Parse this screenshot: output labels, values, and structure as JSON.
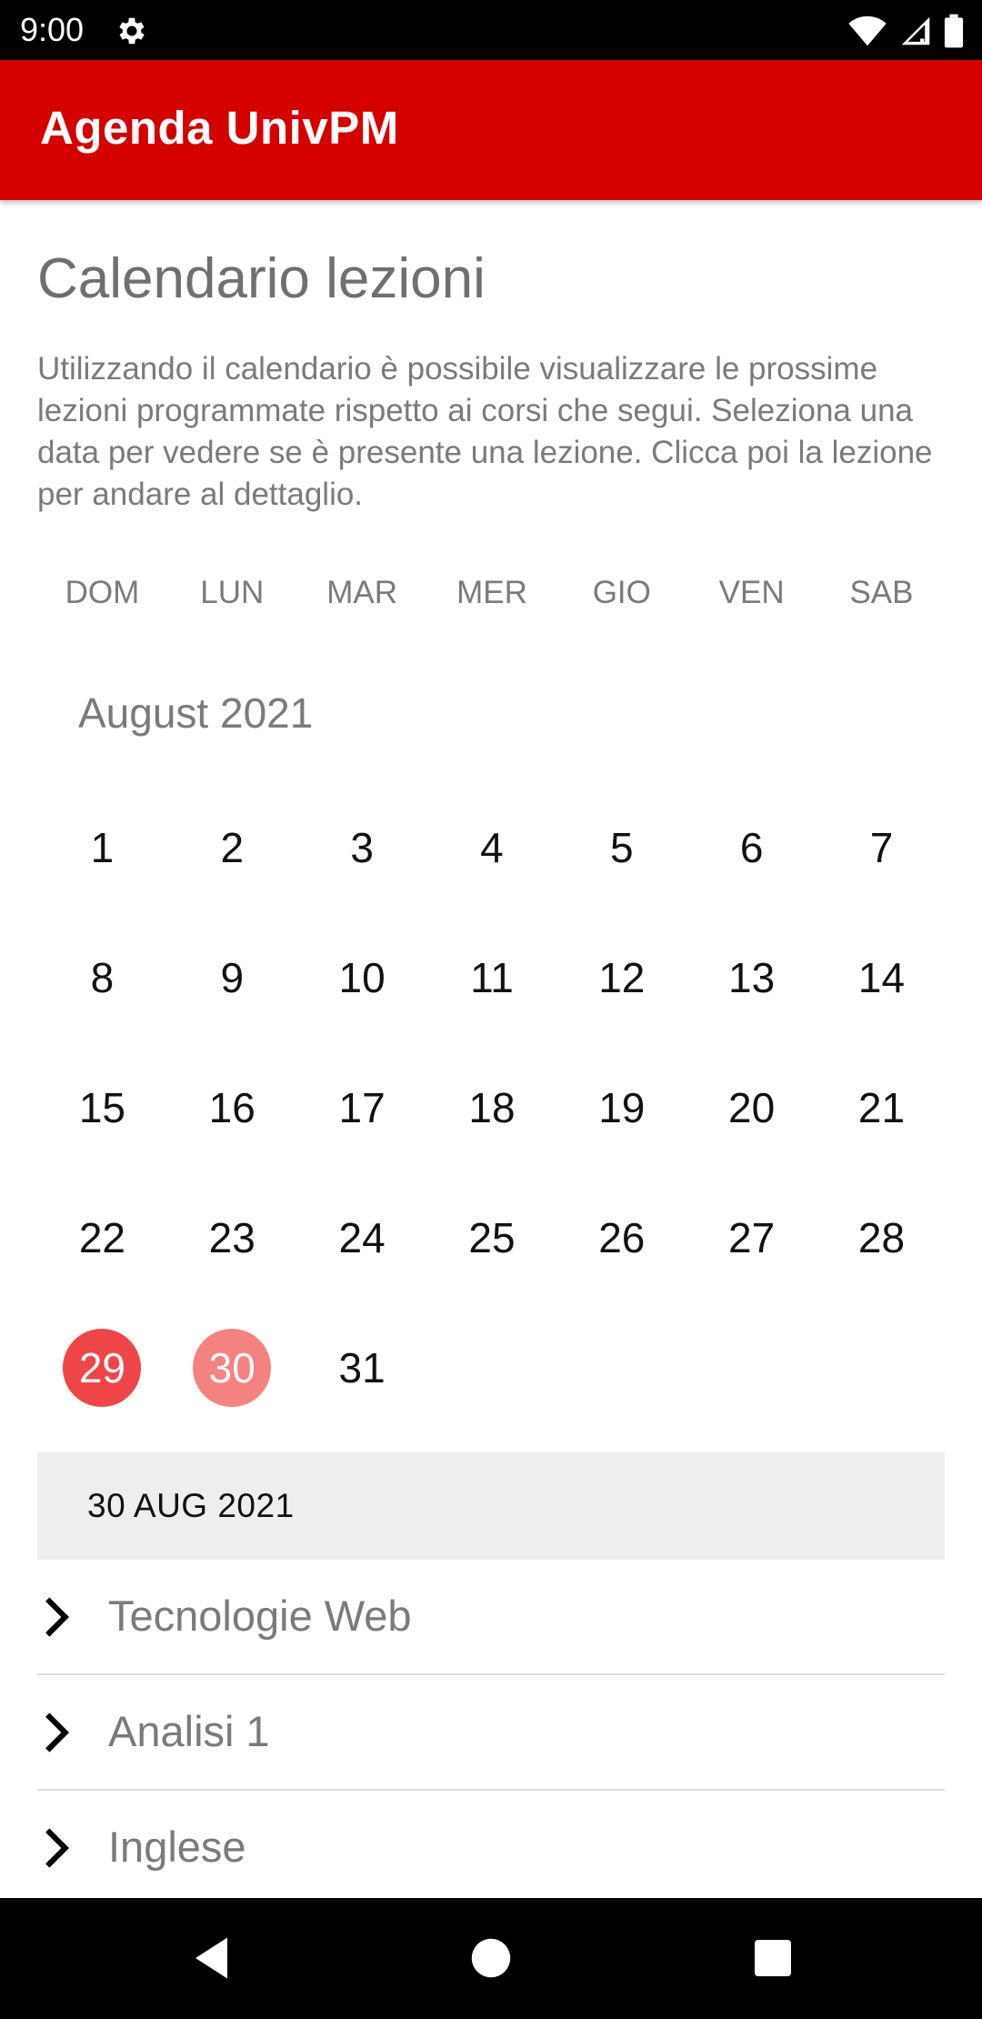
{
  "status_bar": {
    "time": "9:00",
    "icons": [
      "gear-icon",
      "wifi-icon",
      "cellular-signal-icon",
      "battery-icon"
    ]
  },
  "app_bar": {
    "title": "Agenda UnivPM",
    "color": "#d50000"
  },
  "page": {
    "title": "Calendario lezioni",
    "intro": "Utilizzando il calendario è possibile visualizzare le prossime lezioni programmate rispetto ai corsi che segui. Seleziona una data per vedere se è presente una lezione. Clicca poi la lezione per andare al dettaglio."
  },
  "calendar": {
    "weekdays": [
      "DOM",
      "LUN",
      "MAR",
      "MER",
      "GIO",
      "VEN",
      "SAB"
    ],
    "month_label": "August 2021",
    "weeks": [
      [
        "1",
        "2",
        "3",
        "4",
        "5",
        "6",
        "7"
      ],
      [
        "8",
        "9",
        "10",
        "11",
        "12",
        "13",
        "14"
      ],
      [
        "15",
        "16",
        "17",
        "18",
        "19",
        "20",
        "21"
      ],
      [
        "22",
        "23",
        "24",
        "25",
        "26",
        "27",
        "28"
      ],
      [
        "29",
        "30",
        "31",
        "",
        "",
        "",
        ""
      ]
    ],
    "today_day": "29",
    "selected_day": "30",
    "today_color": "#ee4549",
    "selected_color": "#f4827f"
  },
  "selected_date": {
    "header": "30 AUG 2021"
  },
  "lessons": [
    {
      "label": "Tecnologie Web",
      "icon": "chevron-right-icon"
    },
    {
      "label": "Analisi 1",
      "icon": "chevron-right-icon"
    },
    {
      "label": "Inglese",
      "icon": "chevron-right-icon"
    }
  ],
  "nav_bar": {
    "buttons": [
      "back-icon",
      "home-icon",
      "recents-icon"
    ]
  }
}
